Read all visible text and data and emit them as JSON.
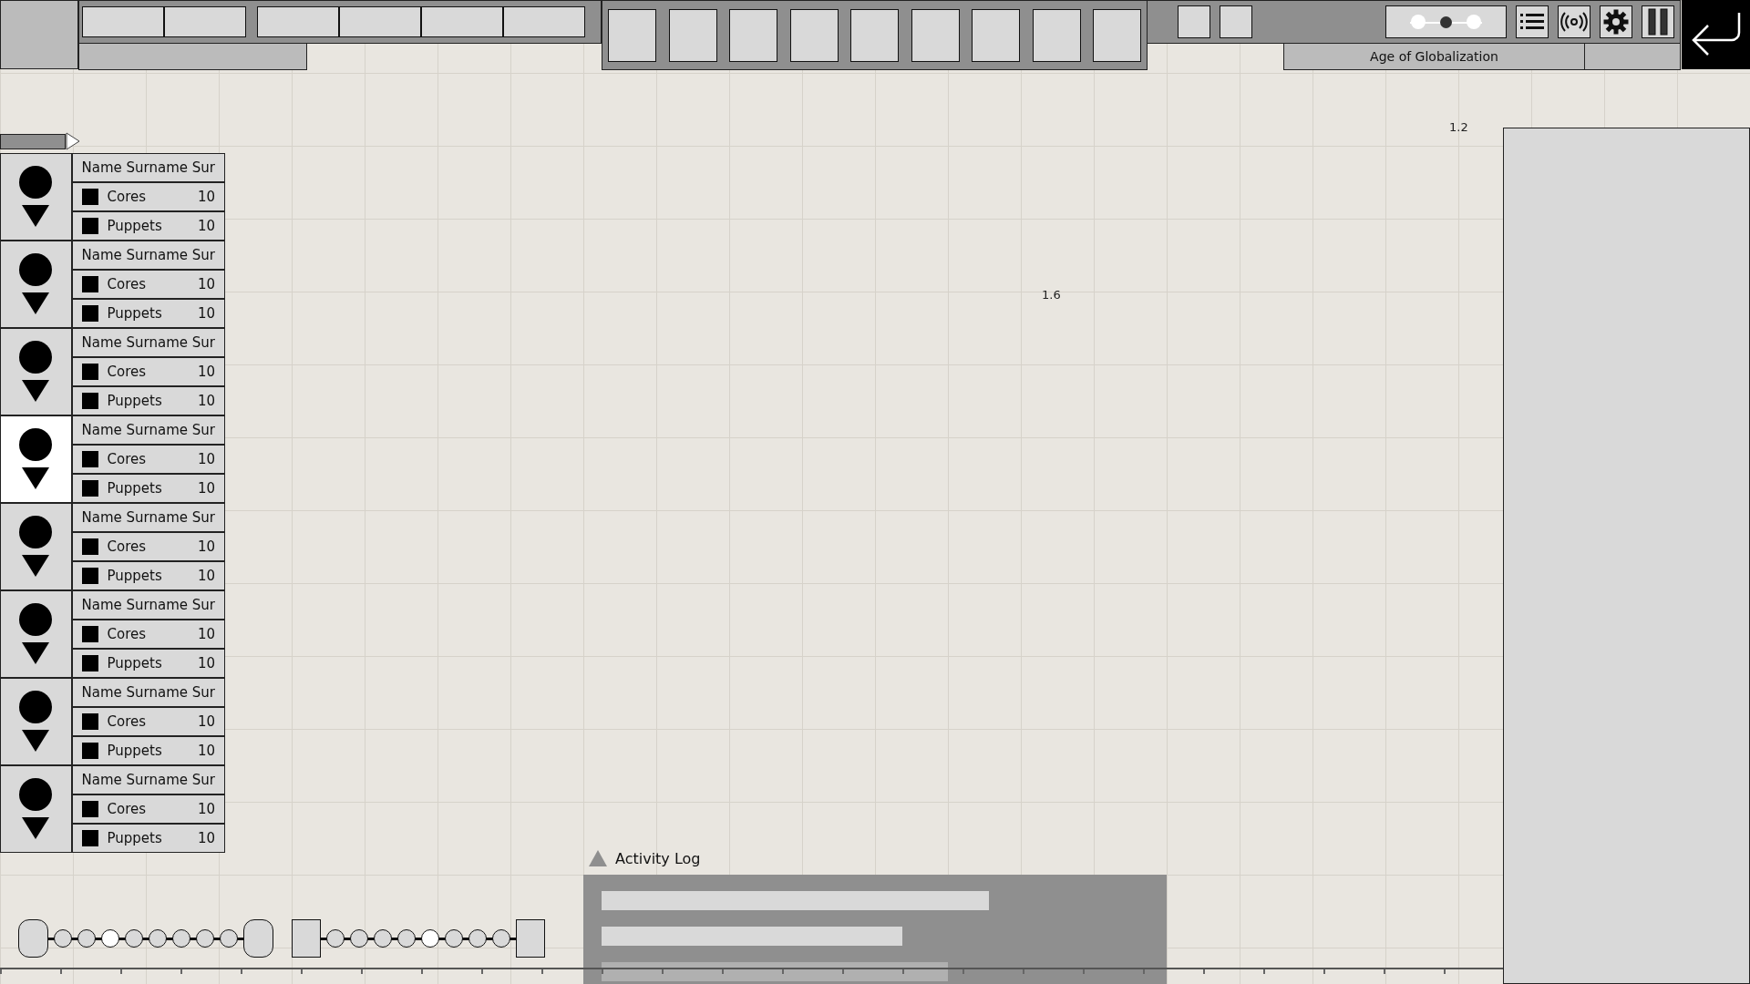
{
  "top_bar": {
    "speed": [
      {
        "selected": false
      },
      {
        "selected": true
      },
      {
        "selected": false
      }
    ],
    "era": "Age of Globalization"
  },
  "map_labels": [
    {
      "text": "1.2",
      "kind": "east"
    },
    {
      "text": "1.6",
      "kind": "middle"
    }
  ],
  "players": [
    {
      "name": "Name Surname Sur",
      "selected": false,
      "stats": [
        {
          "label": "Cores",
          "value": "10"
        },
        {
          "label": "Puppets",
          "value": "10"
        }
      ]
    },
    {
      "name": "Name Surname Sur",
      "selected": false,
      "stats": [
        {
          "label": "Cores",
          "value": "10"
        },
        {
          "label": "Puppets",
          "value": "10"
        }
      ]
    },
    {
      "name": "Name Surname Sur",
      "selected": false,
      "stats": [
        {
          "label": "Cores",
          "value": "10"
        },
        {
          "label": "Puppets",
          "value": "10"
        }
      ]
    },
    {
      "name": "Name Surname Sur",
      "selected": true,
      "stats": [
        {
          "label": "Cores",
          "value": "10"
        },
        {
          "label": "Puppets",
          "value": "10"
        }
      ]
    },
    {
      "name": "Name Surname Sur",
      "selected": false,
      "stats": [
        {
          "label": "Cores",
          "value": "10"
        },
        {
          "label": "Puppets",
          "value": "10"
        }
      ]
    },
    {
      "name": "Name Surname Sur",
      "selected": false,
      "stats": [
        {
          "label": "Cores",
          "value": "10"
        },
        {
          "label": "Puppets",
          "value": "10"
        }
      ]
    },
    {
      "name": "Name Surname Sur",
      "selected": false,
      "stats": [
        {
          "label": "Cores",
          "value": "10"
        },
        {
          "label": "Puppets",
          "value": "10"
        }
      ]
    },
    {
      "name": "Name Surname Sur",
      "selected": false,
      "stats": [
        {
          "label": "Cores",
          "value": "10"
        },
        {
          "label": "Puppets",
          "value": "10"
        }
      ]
    }
  ],
  "timelines": [
    {
      "kind": "rounded",
      "nodes": [
        {
          "selected": false
        },
        {
          "selected": false
        },
        {
          "selected": true
        },
        {
          "selected": false
        },
        {
          "selected": false
        },
        {
          "selected": false
        },
        {
          "selected": false
        },
        {
          "selected": false
        }
      ]
    },
    {
      "kind": "square",
      "nodes": [
        {
          "selected": false
        },
        {
          "selected": false
        },
        {
          "selected": false
        },
        {
          "selected": false
        },
        {
          "selected": true
        },
        {
          "selected": false
        },
        {
          "selected": false
        },
        {
          "selected": false
        }
      ]
    }
  ],
  "activity_log": {
    "title": "Activity Log"
  }
}
